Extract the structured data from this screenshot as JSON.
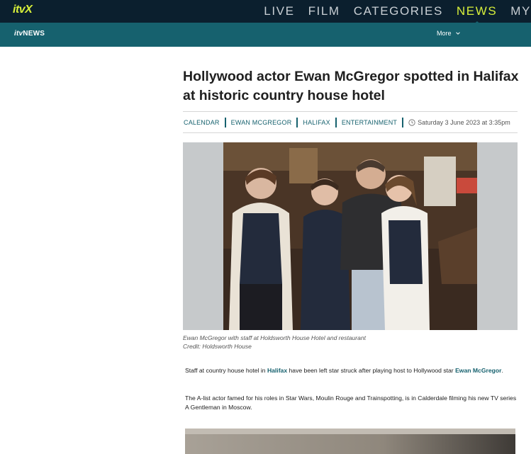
{
  "itvx": {
    "logo": "itvX",
    "nav": [
      {
        "label": "LIVE",
        "active": false
      },
      {
        "label": "FILM",
        "active": false
      },
      {
        "label": "CATEGORIES",
        "active": false
      },
      {
        "label": "NEWS",
        "active": true
      },
      {
        "label": "MY",
        "active": false
      }
    ]
  },
  "news_header": {
    "logo_itv": "itv",
    "logo_news": "NEWS",
    "more_label": "More"
  },
  "article": {
    "headline": "Hollywood actor Ewan McGregor spotted in Halifax at historic country house hotel",
    "tags": [
      "CALENDAR",
      "EWAN MCGREGOR",
      "HALIFAX",
      "ENTERTAINMENT"
    ],
    "date": "Saturday 3 June 2023 at 3:35pm",
    "caption_line1": "Ewan McGregor with staff at Holdsworth House Hotel and restaurant",
    "caption_line2": "Credit: Holdsworth House",
    "p1": {
      "before": "Staff at country house hotel in ",
      "link1": "Halifax",
      "middle": " have been left star struck after playing host to Hollywood star ",
      "link2": "Ewan McGregor",
      "after": "."
    },
    "p2": "The A-list actor famed for his roles in Star Wars, Moulin Rouge and Trainspotting, is in Calderdale filming his new TV series A Gentleman in Moscow."
  },
  "colors": {
    "itvx_bar": "#0b1f2e",
    "accent_yellow": "#d7ef3a",
    "news_teal": "#16616e"
  }
}
